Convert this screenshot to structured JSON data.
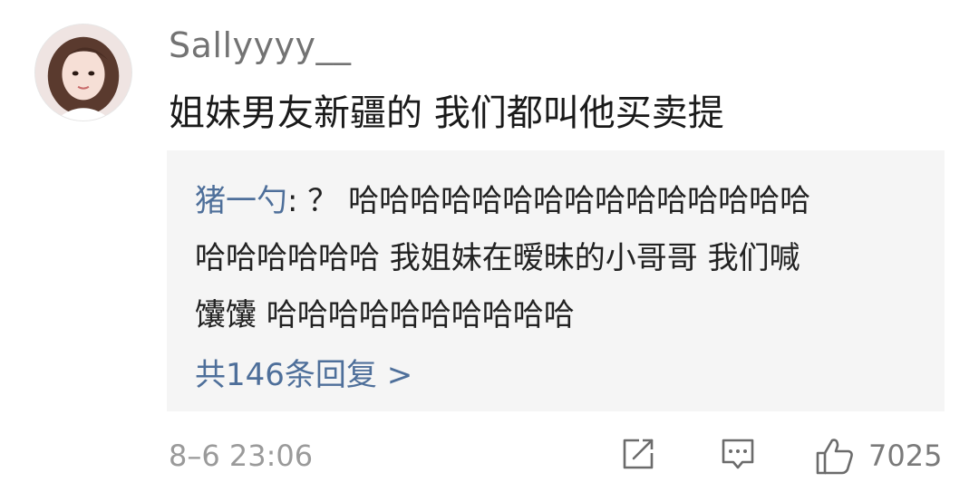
{
  "comment": {
    "username": "Sallyyyy__",
    "text": "姐妹男友新疆的 我们都叫他买卖提",
    "avatar_icon": "user-avatar-photo"
  },
  "reply_preview": {
    "author": "猪一勺",
    "line1_rest": ": ？ 哈哈哈哈哈哈哈哈哈哈哈哈哈哈哈",
    "line2": "哈哈哈哈哈哈 我姐妹在暧昧的小哥哥 我们喊",
    "line3": "馕馕 哈哈哈哈哈哈哈哈哈哈",
    "total_replies": "共146条回复 >"
  },
  "footer": {
    "timestamp": "8–6 23:06",
    "like_count": "7025",
    "icons": [
      "share-icon",
      "reply-icon",
      "like-icon"
    ]
  },
  "colors": {
    "link": "#4e6f9a",
    "reply_bg": "#f5f5f5",
    "meta": "#9a9a9a"
  }
}
